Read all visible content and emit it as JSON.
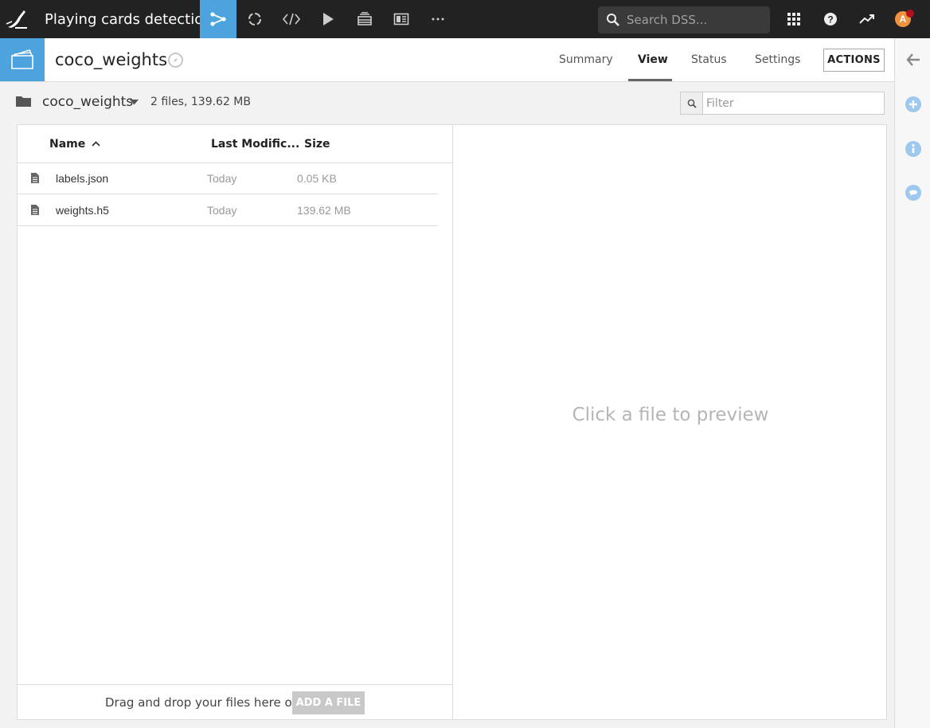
{
  "topbar": {
    "project_title": "Playing cards detection",
    "search_placeholder": "Search DSS...",
    "avatar_initial": "A",
    "nav_icons": [
      "flow-icon",
      "recycle-icon",
      "code-icon",
      "play-icon",
      "stack-icon",
      "dashboard-icon",
      "more-icon"
    ],
    "right_icons": [
      "apps-grid-icon",
      "help-icon",
      "trend-icon"
    ],
    "accent_color": "#4ca3dd"
  },
  "object": {
    "title": "coco_weights",
    "tabs": [
      {
        "label": "Summary",
        "active": false
      },
      {
        "label": "View",
        "active": true
      },
      {
        "label": "Status",
        "active": false
      },
      {
        "label": "Settings",
        "active": false
      }
    ],
    "actions_label": "ACTIONS"
  },
  "folder": {
    "name": "coco_weights",
    "info": "2 files, 139.62 MB",
    "filter_placeholder": "Filter"
  },
  "table": {
    "columns": [
      "Name",
      "Last Modific...",
      "Size"
    ],
    "sort": {
      "column": "Name",
      "direction": "asc"
    },
    "rows": [
      {
        "name": "labels.json",
        "modified": "Today",
        "size": "0.05 KB"
      },
      {
        "name": "weights.h5",
        "modified": "Today",
        "size": "139.62 MB"
      }
    ]
  },
  "dropzone": {
    "text": "Drag and drop your files here or",
    "button_label": "ADD A FILE"
  },
  "preview": {
    "placeholder": "Click a file to preview"
  },
  "rail": {
    "icons": [
      "back-arrow-icon",
      "plus-circle-icon",
      "info-circle-icon",
      "chat-circle-icon"
    ]
  }
}
